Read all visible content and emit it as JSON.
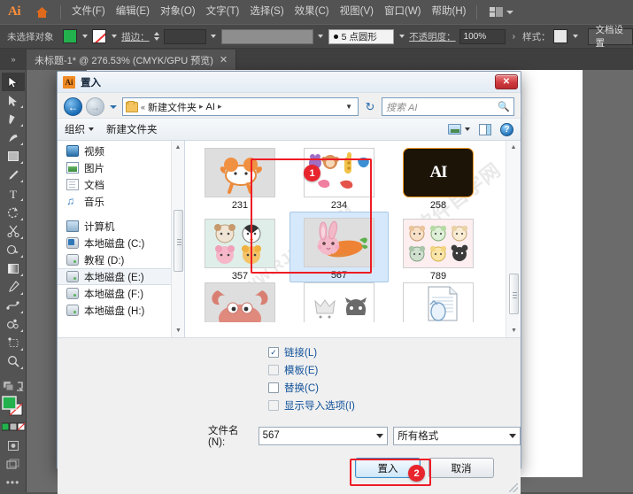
{
  "app": {
    "logo": "Ai",
    "home_icon": "home-icon",
    "menus": [
      "文件(F)",
      "编辑(E)",
      "对象(O)",
      "文字(T)",
      "选择(S)",
      "效果(C)",
      "视图(V)",
      "窗口(W)",
      "帮助(H)"
    ],
    "workspace_switcher": "workspace-icon"
  },
  "control_bar": {
    "selection_status": "未选择对象",
    "fill_color": "#22b14c",
    "stroke_color": "none",
    "stroke_label": "描边：",
    "stroke_width": "",
    "brush_value": "5 点圆形",
    "opacity_label": "不透明度：",
    "opacity_value": "100%",
    "style_label": "样式：",
    "doc_settings": "文档设置"
  },
  "document_tab": {
    "title": "未标题-1* @ 276.53% (CMYK/GPU 预览)",
    "close": "✕"
  },
  "toolbar": {
    "tools": [
      {
        "name": "selection-tool",
        "glyph": "▷",
        "active": true
      },
      {
        "name": "direct-selection-tool",
        "glyph": "▶"
      },
      {
        "name": "pen-tool",
        "glyph": "✒"
      },
      {
        "name": "curvature-tool",
        "glyph": "✑"
      },
      {
        "name": "rectangle-tool",
        "glyph": "▭"
      },
      {
        "name": "paintbrush-tool",
        "glyph": "🖌"
      },
      {
        "name": "type-tool",
        "glyph": "T"
      },
      {
        "name": "rotate-tool",
        "glyph": "↺"
      },
      {
        "name": "scissors-tool",
        "glyph": "✂"
      },
      {
        "name": "shape-builder-tool",
        "glyph": "◍"
      },
      {
        "name": "gradient-tool",
        "glyph": "▤"
      },
      {
        "name": "eyedropper-tool",
        "glyph": "⚲"
      },
      {
        "name": "blend-tool",
        "glyph": "✇"
      },
      {
        "name": "symbol-sprayer-tool",
        "glyph": "❀"
      },
      {
        "name": "artboard-tool",
        "glyph": "⬚"
      },
      {
        "name": "zoom-tool",
        "glyph": "🔍"
      }
    ],
    "more_tools": "•••"
  },
  "dialog": {
    "title": "置入",
    "app_icon": "Ai",
    "close_label": "✕",
    "address": {
      "crumbs": [
        "«",
        "新建文件夹",
        "AI"
      ],
      "dropdown_icon": "chevron-down-icon",
      "refresh_icon": "refresh-icon"
    },
    "search": {
      "placeholder": "搜索 AI",
      "icon": "search-icon"
    },
    "toolbar": {
      "organize": "组织",
      "new_folder": "新建文件夹",
      "view_icon": "views-icon",
      "preview_icon": "preview-pane-icon",
      "help_icon": "help-icon"
    },
    "nav_pane": {
      "items": [
        {
          "label": "视频",
          "icon": "video-icon",
          "type": "video"
        },
        {
          "label": "图片",
          "icon": "pictures-icon",
          "type": "pic"
        },
        {
          "label": "文档",
          "icon": "documents-icon",
          "type": "doc"
        },
        {
          "label": "音乐",
          "icon": "music-icon",
          "type": "music"
        },
        {
          "label": "",
          "type": "gap"
        },
        {
          "label": "计算机",
          "icon": "computer-icon",
          "type": "pc"
        },
        {
          "label": "本地磁盘 (C:)",
          "icon": "disk-c-icon",
          "type": "diskc"
        },
        {
          "label": "教程 (D:)",
          "icon": "disk-icon",
          "type": "disk"
        },
        {
          "label": "本地磁盘 (E:)",
          "icon": "disk-icon",
          "type": "disk",
          "selected": true
        },
        {
          "label": "本地磁盘 (F:)",
          "icon": "disk-icon",
          "type": "disk"
        },
        {
          "label": "本地磁盘 (H:)",
          "icon": "disk-icon",
          "type": "disk"
        }
      ]
    },
    "files": [
      {
        "name": "231",
        "thumb": "cow",
        "style": "grey"
      },
      {
        "name": "234",
        "thumb": "animals-row",
        "style": "white"
      },
      {
        "name": "258",
        "thumb": "AI",
        "style": "black"
      },
      {
        "name": "357",
        "thumb": "four-faces",
        "style": "mint"
      },
      {
        "name": "567",
        "thumb": "rabbit-carrot",
        "style": "grey",
        "selected": true
      },
      {
        "name": "789",
        "thumb": "six-cats",
        "style": "pink"
      },
      {
        "name": "",
        "thumb": "crab",
        "style": "white"
      },
      {
        "name": "",
        "thumb": "crown-cat",
        "style": "white"
      },
      {
        "name": "",
        "thumb": "page-doc",
        "style": "white"
      }
    ],
    "options": [
      {
        "label": "链接(L)",
        "checked": true,
        "enabled": true
      },
      {
        "label": "模板(E)",
        "checked": false,
        "enabled": false
      },
      {
        "label": "替换(C)",
        "checked": false,
        "enabled": true
      },
      {
        "label": "显示导入选项(I)",
        "checked": false,
        "enabled": false
      }
    ],
    "filename": {
      "label": "文件名(N):",
      "value": "567"
    },
    "filetype": {
      "value": "所有格式"
    },
    "buttons": {
      "place": "置入",
      "cancel": "取消"
    },
    "annotations": [
      {
        "badge": "1",
        "target": "selected-file-567"
      },
      {
        "badge": "2",
        "target": "place-button"
      }
    ]
  },
  "watermark": {
    "line1": "软件自学网",
    "line2": "WWW.RJZXW.COM"
  },
  "colors": {
    "app_bg": "#535353",
    "accent_red": "#ee1c25",
    "fill_green": "#22b14c",
    "dialog_bg": "#f0f0f0",
    "link_blue": "#11519a"
  }
}
